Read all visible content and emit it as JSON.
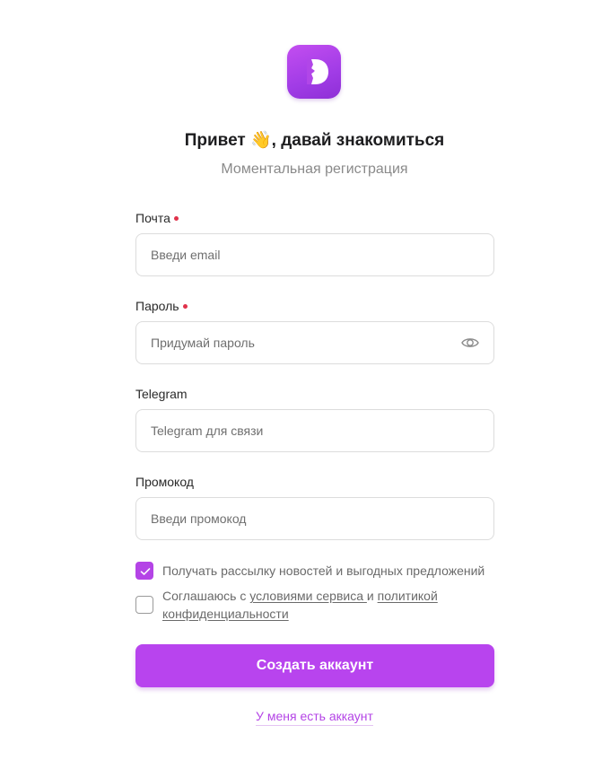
{
  "brand": {
    "logo_icon": "d-letter-logo-icon",
    "accent_color": "#b844ee"
  },
  "header": {
    "title": "Привет 👋, давай знакомиться",
    "subtitle": "Моментальная регистрация"
  },
  "form": {
    "email": {
      "label": "Почта",
      "required": true,
      "placeholder": "Введи email",
      "value": ""
    },
    "password": {
      "label": "Пароль",
      "required": true,
      "placeholder": "Придумай пароль",
      "value": "",
      "toggle_icon": "eye-icon"
    },
    "telegram": {
      "label": "Telegram",
      "required": false,
      "placeholder": "Telegram для связи",
      "value": ""
    },
    "promo": {
      "label": "Промокод",
      "required": false,
      "placeholder": "Введи промокод",
      "value": ""
    }
  },
  "checkboxes": {
    "newsletter": {
      "checked": true,
      "text": "Получать рассылку новостей и выгодных предложений"
    },
    "terms": {
      "checked": false,
      "prefix": "Соглашаюсь с ",
      "terms_link": "условиями сервиса ",
      "and": " и ",
      "privacy_link_part1": "политикой",
      "privacy_link_part2": "конфиденциальности"
    }
  },
  "actions": {
    "submit_label": "Создать аккаунт",
    "login_link": "У меня есть аккаунт"
  }
}
